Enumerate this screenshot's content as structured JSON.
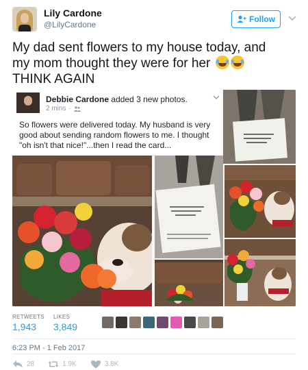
{
  "tweet": {
    "author_name": "Lily Cardone",
    "author_handle": "@LilyCardone",
    "follow_label": "Follow",
    "text_line1": "My dad sent flowers to my house today, and",
    "text_line2": "my mom thought they were for her",
    "text_line3": "THINK AGAIN"
  },
  "embedded_post": {
    "author": "Debbie Cardone",
    "action_text": "added 3 new photos.",
    "time": "2 mins",
    "separator": "·",
    "body": "So flowers were delivered today. My husband is very good about sending random flowers to me. I thought \"oh isn't that nice!\"...then I read the card..."
  },
  "stats": {
    "retweets_label": "RETWEETS",
    "retweets_value": "1,943",
    "likes_label": "LIKES",
    "likes_value": "3,849"
  },
  "likers_colors": [
    "#6f6a66",
    "#3b3632",
    "#8c7b6a",
    "#3a6a7a",
    "#6f4c6e",
    "#e35ab0",
    "#4a4a4a",
    "#a8a39b",
    "#7a6655"
  ],
  "timestamp": "6:23 PM - 1 Feb 2017",
  "actions": {
    "reply_count": "28",
    "retweet_count": "1.9K",
    "like_count": "3.8K"
  },
  "colors": {
    "accent": "#1da1f2",
    "muted": "#657786",
    "action_gray": "#aab8c2"
  }
}
